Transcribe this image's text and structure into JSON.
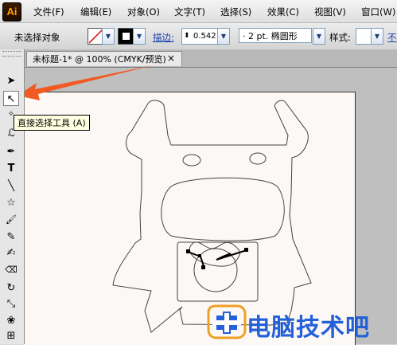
{
  "app": {
    "logo": "Ai"
  },
  "menu": [
    "文件(F)",
    "编辑(E)",
    "对象(O)",
    "文字(T)",
    "选择(S)",
    "效果(C)",
    "视图(V)",
    "窗口(W)"
  ],
  "control_bar": {
    "selection_label": "未选择对象",
    "stroke_link": "描边:",
    "stroke_weight": "0.542",
    "brush_value": "· 2 pt. 椭圆形",
    "style_label": "样式:",
    "cut_text": "不"
  },
  "document_tab": {
    "title": "未标题-1* @ 100% (CMYK/预览)",
    "close": "×"
  },
  "tooltip": {
    "text": "直接选择工具 (A)"
  },
  "tools": [
    {
      "name": "selection-tool",
      "glyph": "➤"
    },
    {
      "name": "direct-selection-tool",
      "glyph": "↖"
    },
    {
      "name": "magic-wand-tool",
      "glyph": "✧"
    },
    {
      "name": "lasso-tool",
      "glyph": "ℒ"
    },
    {
      "name": "pen-tool",
      "glyph": "✒"
    },
    {
      "name": "type-tool",
      "glyph": "T"
    },
    {
      "name": "line-tool",
      "glyph": "╲"
    },
    {
      "name": "star-tool",
      "glyph": "☆"
    },
    {
      "name": "paintbrush-tool",
      "glyph": "🖌"
    },
    {
      "name": "pencil-tool",
      "glyph": "✎"
    },
    {
      "name": "blob-brush-tool",
      "glyph": "✍"
    },
    {
      "name": "eraser-tool",
      "glyph": "⌫"
    },
    {
      "name": "rotate-tool",
      "glyph": "↻"
    },
    {
      "name": "scale-tool",
      "glyph": "⤡"
    },
    {
      "name": "warp-tool",
      "glyph": "❀"
    },
    {
      "name": "free-transform-tool",
      "glyph": "⊞"
    }
  ],
  "colors": {
    "arrow": "#f15a22",
    "watermark": "#2460d8",
    "artboard": "#fbf8f6"
  },
  "watermark": {
    "text": "电脑技术吧"
  }
}
